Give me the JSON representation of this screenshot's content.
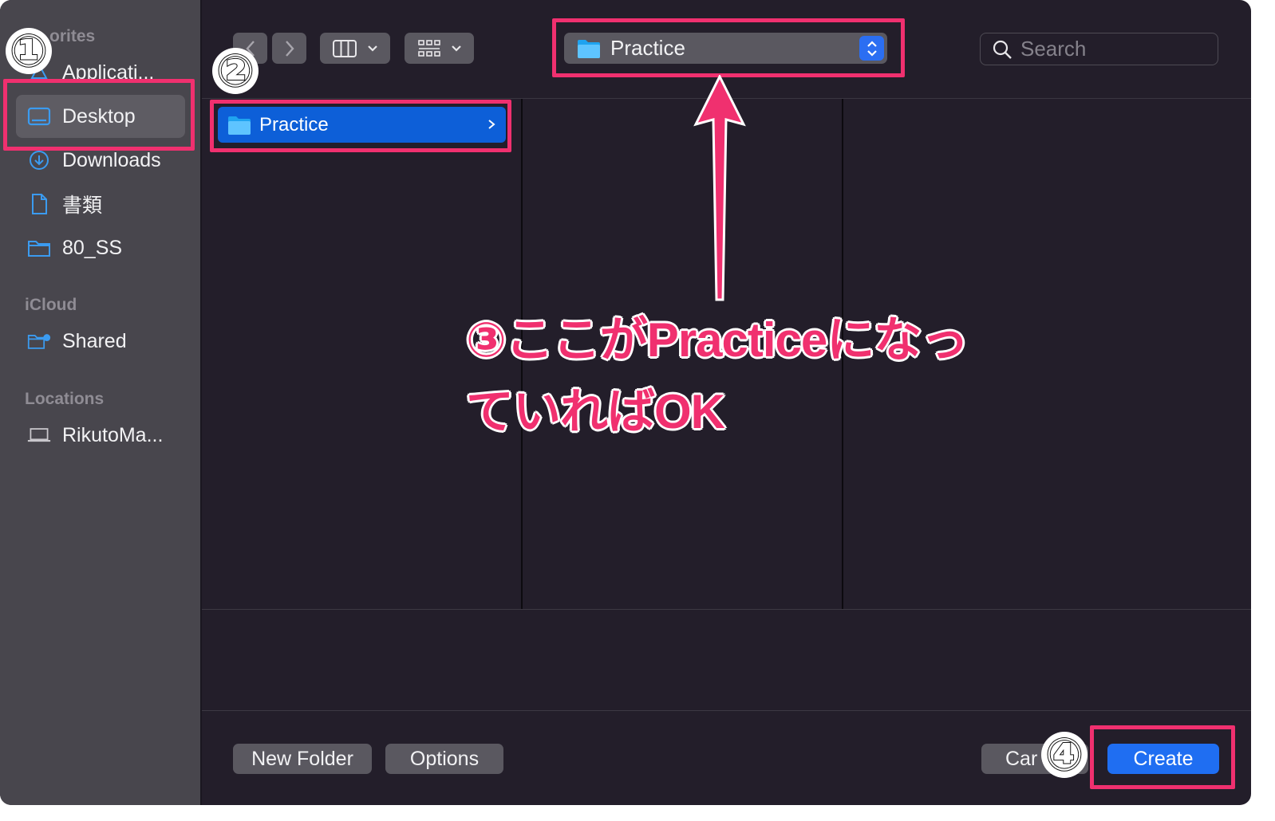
{
  "sidebar": {
    "favorites_title": "orites",
    "icloud_title": "iCloud",
    "locations_title": "Locations",
    "items": [
      {
        "label": "Applicati...",
        "icon": "applications-icon"
      },
      {
        "label": "Desktop",
        "icon": "desktop-icon",
        "selected": true
      },
      {
        "label": "Downloads",
        "icon": "downloads-icon"
      },
      {
        "label": "書類",
        "icon": "document-icon"
      },
      {
        "label": "80_SS",
        "icon": "folder-icon"
      }
    ],
    "icloud_items": [
      {
        "label": "Shared",
        "icon": "shared-folder-icon"
      }
    ],
    "location_items": [
      {
        "label": "RikutoMa...",
        "icon": "laptop-icon"
      }
    ]
  },
  "toolbar": {
    "path": "Practice",
    "search_placeholder": "Search"
  },
  "columns": {
    "selected_folder": "Practice"
  },
  "buttons": {
    "new_folder": "New Folder",
    "options": "Options",
    "cancel": "Car",
    "create": "Create"
  },
  "annotations": {
    "n1": "①",
    "n2": "②",
    "n4": "④",
    "text_line1": "③ここがPracticeになっ",
    "text_line2": "ていればOK"
  },
  "colors": {
    "accent": "#1f6ef2",
    "annotation": "#f0306f",
    "selection": "#0d5fd8"
  }
}
